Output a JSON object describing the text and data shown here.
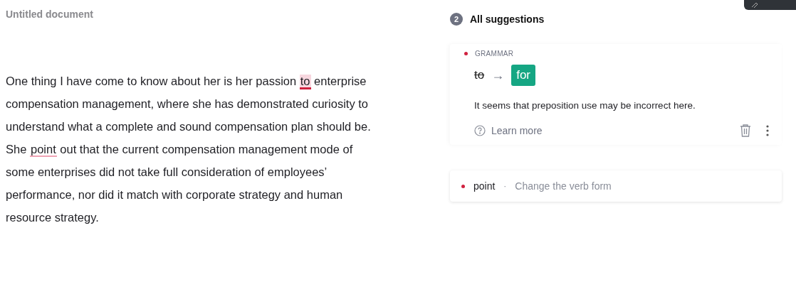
{
  "document": {
    "title": "Untitled document",
    "lines": [
      [
        {
          "kind": "plain",
          "text": "One thing I have come to know about her is her passion "
        },
        {
          "kind": "flag",
          "text": "to",
          "selected": true
        },
        {
          "kind": "plain",
          "text": " enterprise"
        }
      ],
      [
        {
          "kind": "plain",
          "text": "compensation management, where she has demonstrated curiosity to"
        }
      ],
      [
        {
          "kind": "plain",
          "text": "understand what a complete and sound compensation plan should be."
        }
      ],
      [
        {
          "kind": "plain",
          "text": "She "
        },
        {
          "kind": "flag",
          "text": "point",
          "selected": false
        },
        {
          "kind": "plain",
          "text": " out that the current compensation management mode of"
        }
      ],
      [
        {
          "kind": "plain",
          "text": "some enterprises did not take full consideration of employees’"
        }
      ],
      [
        {
          "kind": "plain",
          "text": "performance, nor did it match with corporate strategy and human"
        }
      ],
      [
        {
          "kind": "plain",
          "text": "resource strategy."
        }
      ]
    ]
  },
  "suggestions": {
    "count": "2",
    "title": "All suggestions",
    "items": [
      {
        "expanded": true,
        "color": "#d0213f",
        "category": "GRAMMAR",
        "original": "to",
        "arrow": "→",
        "replacement": "for",
        "explanation": "It seems that preposition use may be incorrect here.",
        "link": "Learn more"
      },
      {
        "expanded": false,
        "color": "#d0213f",
        "word": "point",
        "separator": "·",
        "hint": "Change the verb form"
      }
    ]
  }
}
